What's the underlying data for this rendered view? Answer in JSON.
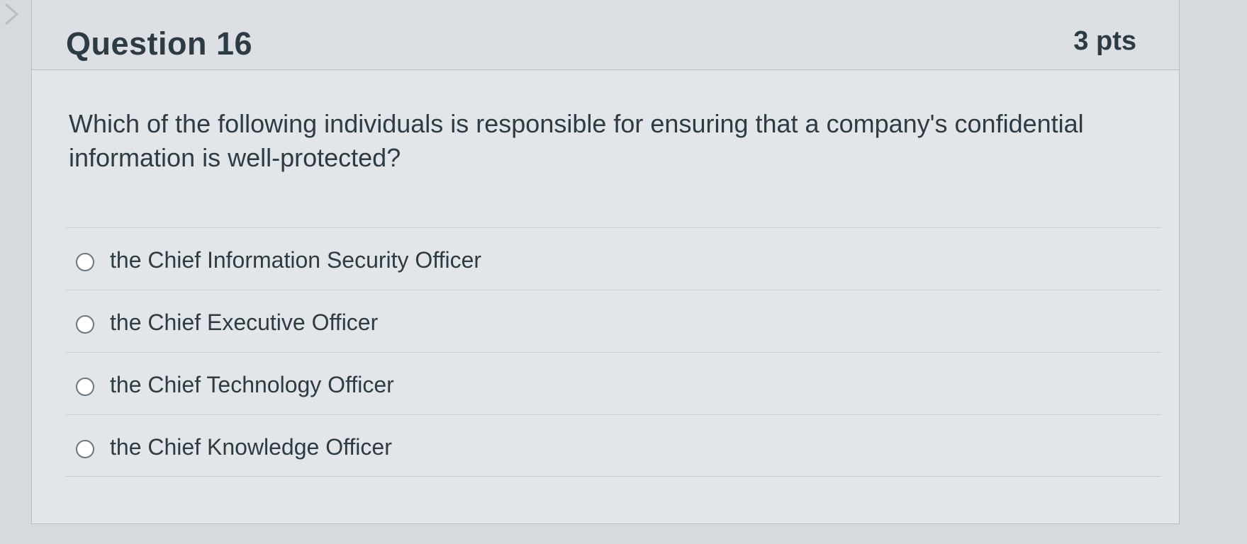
{
  "question": {
    "title": "Question 16",
    "points": "3 pts",
    "text": "Which of the following individuals is responsible for ensuring that a company's confidential information is well-protected?"
  },
  "answers": [
    {
      "label": "the Chief Information Security Officer"
    },
    {
      "label": "the Chief Executive Officer"
    },
    {
      "label": "the Chief Technology Officer"
    },
    {
      "label": "the Chief Knowledge Officer"
    }
  ],
  "colors": {
    "text": "#2d3b45",
    "border": "#b9bec2",
    "card_background": "#e3e6e8"
  },
  "icons": {
    "left_arrow": "chevron-right-icon",
    "radio": "radio-unselected-icon"
  }
}
